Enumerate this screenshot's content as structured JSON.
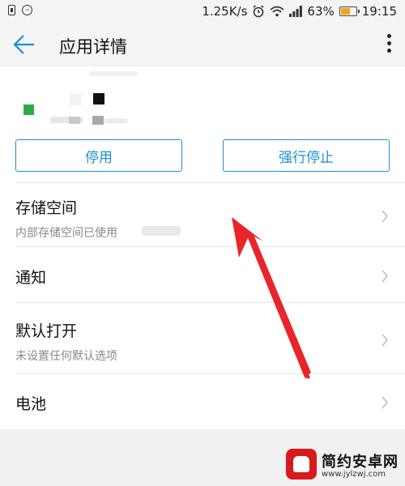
{
  "status_bar": {
    "speed": "1.25K/s",
    "battery_percent": "63%",
    "battery_level": 0.63,
    "time": "19:15",
    "icons": [
      "battery-saver-icon",
      "more-dots-icon",
      "alarm-icon",
      "wifi-icon",
      "signal-icon"
    ]
  },
  "header": {
    "title": "应用详情",
    "back_icon": "arrow-left-icon",
    "menu_icon": "more-vert-icon"
  },
  "actions": {
    "disable_label": "停用",
    "force_stop_label": "强行停止"
  },
  "rows": [
    {
      "title": "存储空间",
      "subtitle": "内部存储空间已使用"
    },
    {
      "title": "通知",
      "subtitle": ""
    },
    {
      "title": "默认打开",
      "subtitle": "未设置任何默认选项"
    },
    {
      "title": "电池",
      "subtitle": ""
    }
  ],
  "watermark": {
    "name": "简约安卓网",
    "url": "www.jylzwj.com"
  },
  "colors": {
    "accent": "#1a8fd4",
    "annotation_arrow": "#e8262a",
    "battery": "#f5a31a"
  }
}
